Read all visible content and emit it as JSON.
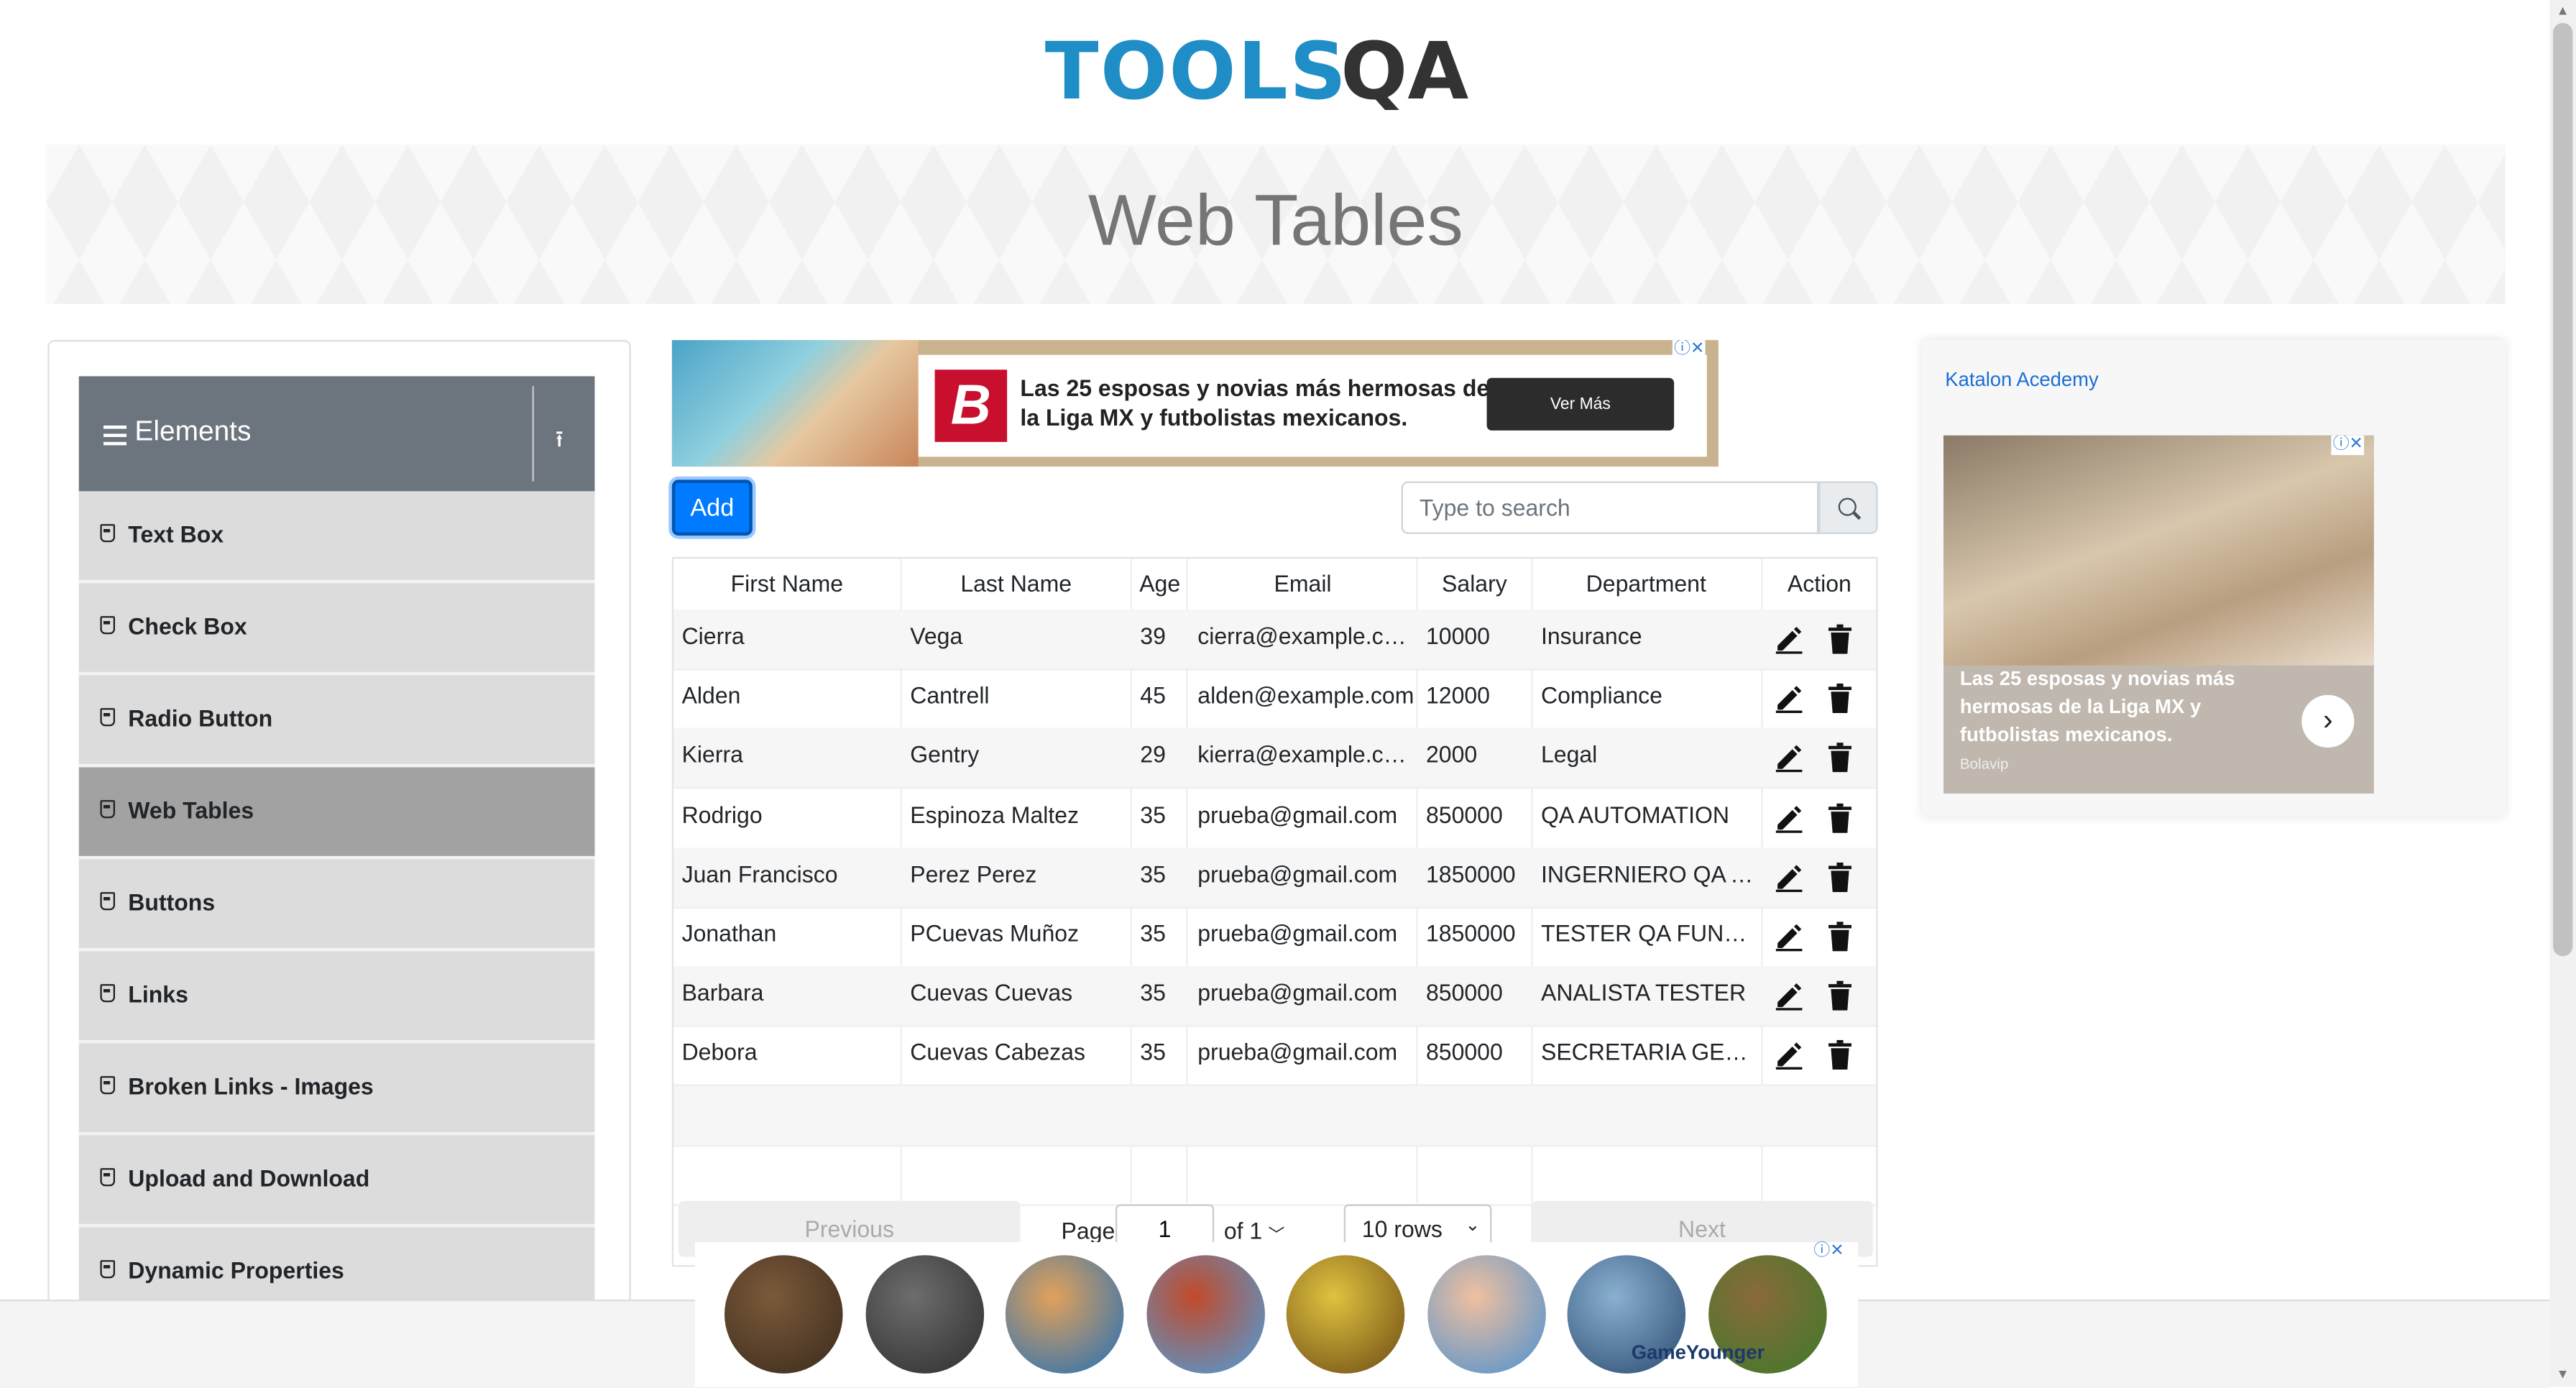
{
  "header": {
    "logo_text_left": "TOOLS",
    "logo_text_right": "QA",
    "page_title": "Web Tables"
  },
  "sidebar": {
    "group_title": "Elements",
    "items": [
      {
        "label": "Text Box"
      },
      {
        "label": "Check Box"
      },
      {
        "label": "Radio Button"
      },
      {
        "label": "Web Tables",
        "active": true
      },
      {
        "label": "Buttons"
      },
      {
        "label": "Links"
      },
      {
        "label": "Broken Links - Images"
      },
      {
        "label": "Upload and Download"
      },
      {
        "label": "Dynamic Properties"
      }
    ]
  },
  "ad_top": {
    "headline": "Las 25 esposas y novias más hermosas de la Liga MX y futbolistas mexicanos.",
    "cta": "Ver Más",
    "logo_letter": "B"
  },
  "ad_right": {
    "link_text": "Katalon Acedemy",
    "caption": "Las 25 esposas y novias más hermosas de la Liga MX y futbolistas mexicanos.",
    "source": "Bolavip"
  },
  "controls": {
    "add_label": "Add",
    "search_placeholder": "Type to search"
  },
  "table": {
    "columns": [
      "First Name",
      "Last Name",
      "Age",
      "Email",
      "Salary",
      "Department",
      "Action"
    ],
    "rows": [
      {
        "first": "Cierra",
        "last": "Vega",
        "age": "39",
        "email": "cierra@example.com",
        "salary": "10000",
        "dept": "Insurance"
      },
      {
        "first": "Alden",
        "last": "Cantrell",
        "age": "45",
        "email": "alden@example.com",
        "salary": "12000",
        "dept": "Compliance"
      },
      {
        "first": "Kierra",
        "last": "Gentry",
        "age": "29",
        "email": "kierra@example.com",
        "salary": "2000",
        "dept": "Legal"
      },
      {
        "first": "Rodrigo",
        "last": "Espinoza Maltez",
        "age": "35",
        "email": "prueba@gmail.com",
        "salary": "850000",
        "dept": "QA AUTOMATION"
      },
      {
        "first": "Juan Francisco",
        "last": "Perez Perez",
        "age": "35",
        "email": "prueba@gmail.com",
        "salary": "1850000",
        "dept": "INGERNIERO QA A..."
      },
      {
        "first": "Jonathan",
        "last": "PCuevas Muñoz",
        "age": "35",
        "email": "prueba@gmail.com",
        "salary": "1850000",
        "dept": "TESTER QA FUNCI..."
      },
      {
        "first": "Barbara",
        "last": "Cuevas Cuevas",
        "age": "35",
        "email": "prueba@gmail.com",
        "salary": "850000",
        "dept": "ANALISTA TESTER"
      },
      {
        "first": "Debora",
        "last": "Cuevas Cabezas",
        "age": "35",
        "email": "prueba@gmail.com",
        "salary": "850000",
        "dept": "SECRETARIA GERE..."
      }
    ]
  },
  "pagination": {
    "previous": "Previous",
    "next": "Next",
    "page_label": "Page",
    "page_value": "1",
    "of_label": "of 1",
    "rows_label": "10 rows"
  },
  "game_ad": {
    "brand": "GameYounger"
  }
}
